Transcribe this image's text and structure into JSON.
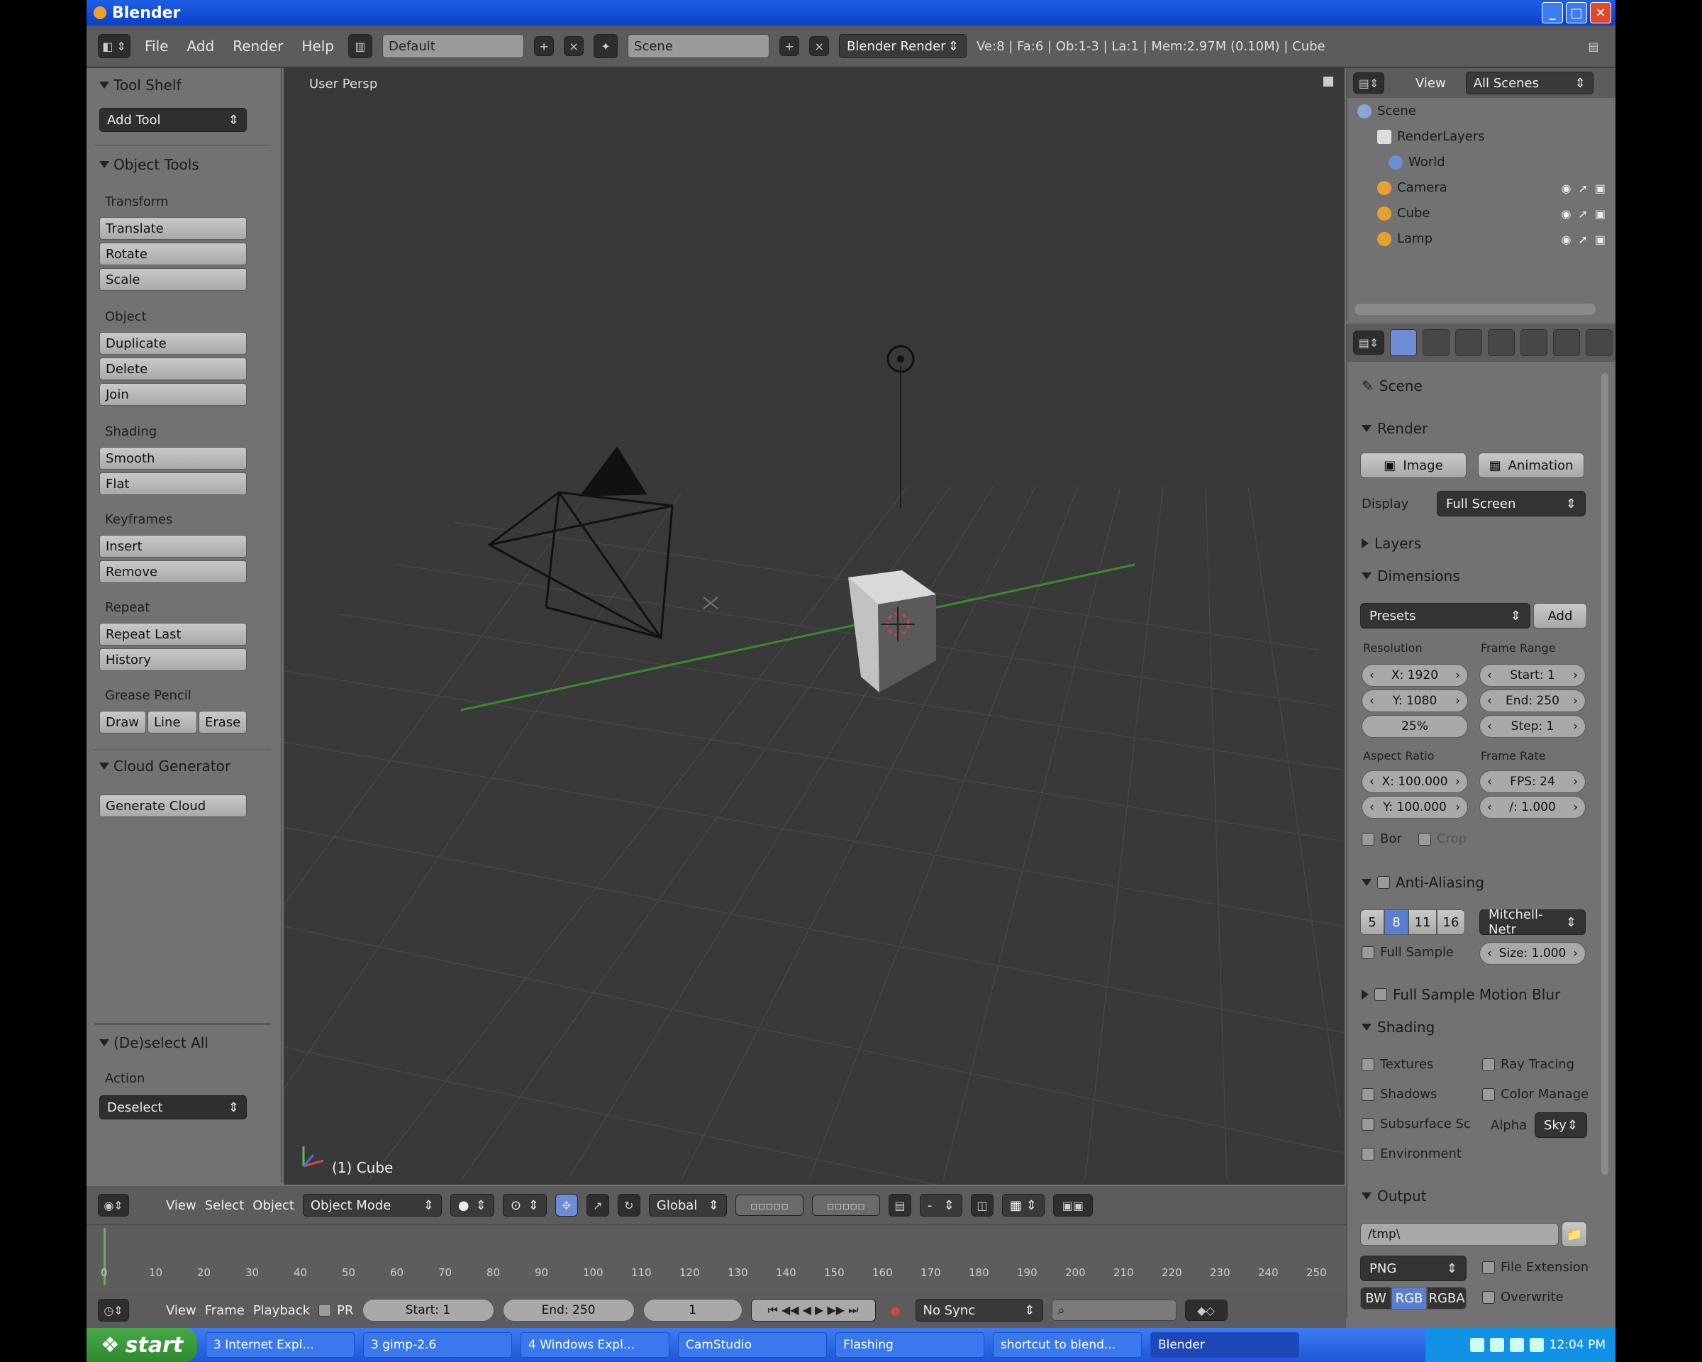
{
  "window": {
    "title": "Blender"
  },
  "header": {
    "menus": [
      "File",
      "Add",
      "Render",
      "Help"
    ],
    "screen_layout": "Default",
    "scene": "Scene",
    "engine": "Blender Render",
    "stats": "Ve:8 | Fa:6 | Ob:1-3 | La:1 | Mem:2.97M (0.10M) | Cube"
  },
  "toolshelf": {
    "tool_shelf_title": "Tool Shelf",
    "add_tool": "Add Tool",
    "object_tools_title": "Object Tools",
    "transform": {
      "label": "Transform",
      "buttons": [
        "Translate",
        "Rotate",
        "Scale"
      ]
    },
    "object": {
      "label": "Object",
      "buttons": [
        "Duplicate",
        "Delete",
        "Join"
      ]
    },
    "shading": {
      "label": "Shading",
      "buttons": [
        "Smooth",
        "Flat"
      ]
    },
    "keyframes": {
      "label": "Keyframes",
      "buttons": [
        "Insert",
        "Remove"
      ]
    },
    "repeat": {
      "label": "Repeat",
      "buttons": [
        "Repeat Last",
        "History"
      ]
    },
    "grease_pencil": {
      "label": "Grease Pencil",
      "buttons": [
        "Draw",
        "Line",
        "Erase"
      ]
    },
    "cloud_generator_title": "Cloud Generator",
    "generate_cloud": "Generate Cloud",
    "operator_title": "(De)select All",
    "action_label": "Action",
    "action_value": "Deselect"
  },
  "viewport": {
    "title": "User Persp",
    "object_label": "(1) Cube"
  },
  "outliner": {
    "view_label": "View",
    "filter": "All Scenes",
    "items": [
      {
        "name": "Scene",
        "icon": "scene-icon",
        "color": "#8aa5d6"
      },
      {
        "name": "RenderLayers",
        "icon": "render-layers-icon",
        "color": "#dddddd"
      },
      {
        "name": "World",
        "icon": "world-icon",
        "color": "#6d8ed6"
      },
      {
        "name": "Camera",
        "icon": "camera-icon",
        "color": "#e8a032"
      },
      {
        "name": "Cube",
        "icon": "mesh-icon",
        "color": "#e8a032"
      },
      {
        "name": "Lamp",
        "icon": "lamp-icon",
        "color": "#e8a032"
      }
    ]
  },
  "properties": {
    "context": "Scene",
    "render_title": "Render",
    "image_button": "Image",
    "animation_button": "Animation",
    "display_label": "Display",
    "display_value": "Full Screen",
    "layers_title": "Layers",
    "dimensions_title": "Dimensions",
    "presets": "Presets",
    "add": "Add",
    "resolution_label": "Resolution",
    "res_x": "X: 1920",
    "res_y": "Y: 1080",
    "res_pct": "25%",
    "frame_range_label": "Frame Range",
    "start": "Start: 1",
    "end": "End: 250",
    "step": "Step: 1",
    "aspect_ratio_label": "Aspect Ratio",
    "aspect_x": "X: 100.000",
    "aspect_y": "Y: 100.000",
    "frame_rate_label": "Frame Rate",
    "fps": "FPS: 24",
    "fps_base": "/: 1.000",
    "border": "Bor",
    "crop": "Crop",
    "aa_title": "Anti-Aliasing",
    "aa_samples": [
      "5",
      "8",
      "11",
      "16"
    ],
    "aa_filter": "Mitchell-Netr",
    "full_sample": "Full Sample",
    "size": "Size: 1.000",
    "motion_blur": "Full Sample Motion Blur",
    "shading_title": "Shading",
    "shading_left": [
      "Textures",
      "Shadows",
      "Subsurface Sc",
      "Environment"
    ],
    "shading_right": [
      "Ray Tracing",
      "Color Manage"
    ],
    "alpha_label": "Alpha",
    "alpha_value": "Sky",
    "output_title": "Output",
    "output_path": "/tmp\\",
    "format": "PNG",
    "file_extensions": "File Extension",
    "color_modes": [
      "BW",
      "RGB",
      "RGBA"
    ],
    "overwrite": "Overwrite"
  },
  "view3d_header": {
    "menus": [
      "View",
      "Select",
      "Object"
    ],
    "mode": "Object Mode",
    "orientation": "Global"
  },
  "timeline": {
    "ticks": [
      "0",
      "10",
      "20",
      "30",
      "40",
      "50",
      "60",
      "70",
      "80",
      "90",
      "100",
      "110",
      "120",
      "130",
      "140",
      "150",
      "160",
      "170",
      "180",
      "190",
      "200",
      "210",
      "220",
      "230",
      "240",
      "250"
    ],
    "menus": [
      "View",
      "Frame",
      "Playback"
    ],
    "pr_label": "PR",
    "start": "Start: 1",
    "end": "End: 250",
    "current": "1",
    "sync": "No Sync"
  },
  "taskbar": {
    "start": "start",
    "tasks": [
      "3 Internet Expl...",
      "3 gimp-2.6",
      "4 Windows Expl...",
      "CamStudio",
      "Flashing",
      "shortcut to blend...",
      "Blender"
    ],
    "time": "12:04 PM"
  }
}
